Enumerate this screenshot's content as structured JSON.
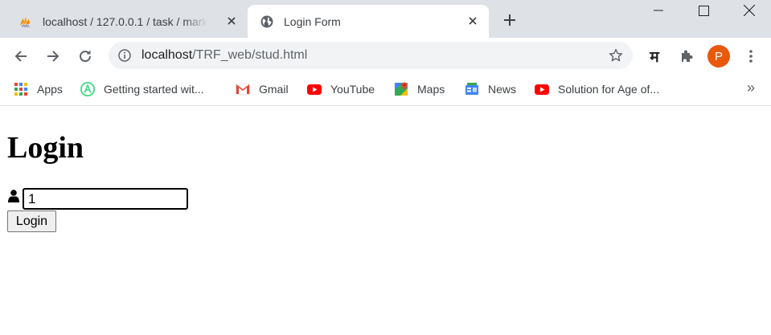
{
  "browser": {
    "tabs": [
      {
        "title": "localhost / 127.0.0.1 / task / mark",
        "favicon": "phpmyadmin-icon",
        "active": false
      },
      {
        "title": "Login Form",
        "favicon": "globe-icon",
        "active": true
      }
    ],
    "address_bar": {
      "host": "localhost",
      "path": "/TRF_web/stud.html"
    },
    "profile_initial": "P",
    "extension_glyph": "म",
    "bookmarks": [
      {
        "label": "Apps",
        "icon": "apps-grid-icon"
      },
      {
        "label": "Getting started wit...",
        "icon": "android-studio-icon"
      },
      {
        "label": "Gmail",
        "icon": "gmail-icon"
      },
      {
        "label": "YouTube",
        "icon": "youtube-icon"
      },
      {
        "label": "Maps",
        "icon": "maps-icon"
      },
      {
        "label": "News",
        "icon": "news-icon"
      },
      {
        "label": "Solution for Age of...",
        "icon": "youtube-icon"
      }
    ],
    "bookmarks_overflow": "»"
  },
  "page": {
    "heading": "Login",
    "input_value": "1",
    "login_button": "Login"
  },
  "colors": {
    "tabstrip": "#dee1e6",
    "omnibox": "#f1f3f4",
    "avatar": "#e8590c",
    "youtube_red": "#ff0000"
  }
}
